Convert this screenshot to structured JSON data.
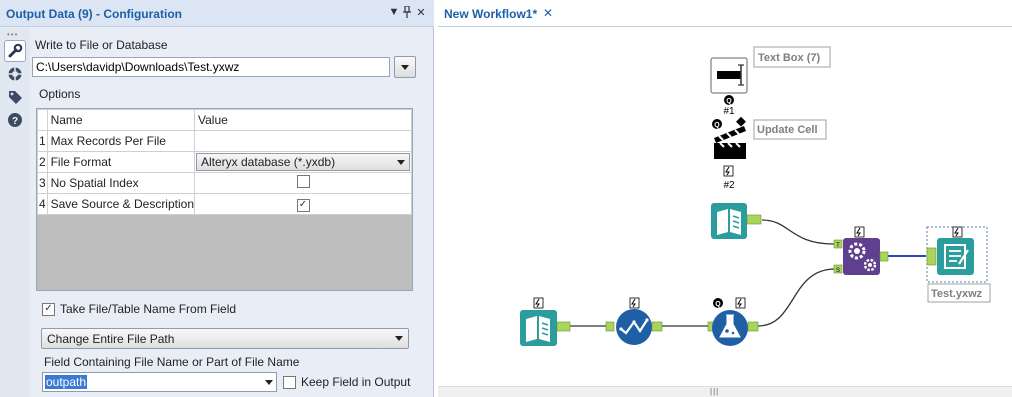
{
  "left_panel": {
    "title": "Output Data (9) - Configuration",
    "write_label": "Write to File or Database",
    "path_value": "C:\\Users\\davidp\\Downloads\\Test.yxwz",
    "options_label": "Options",
    "table": {
      "headers": [
        "Name",
        "Value"
      ],
      "rows": [
        {
          "num": "1",
          "name": "Max Records Per File",
          "value": ""
        },
        {
          "num": "2",
          "name": "File Format",
          "value": "Alteryx database (*.yxdb)"
        },
        {
          "num": "3",
          "name": "No Spatial Index",
          "checked": false
        },
        {
          "num": "4",
          "name": "Save Source & Description",
          "checked": true
        }
      ]
    },
    "take_file_label": "Take File/Table Name From Field",
    "take_file_checked": true,
    "change_path_value": "Change Entire File Path",
    "field_label": "Field Containing File Name or Part of File Name",
    "field_value": "outpath",
    "keep_field_label": "Keep Field in Output",
    "keep_field_checked": false
  },
  "workflow": {
    "tab_label": "New Workflow1*",
    "tools": [
      {
        "name": "Text Box",
        "annotation": "Text Box (7)",
        "badge": "#1"
      },
      {
        "name": "Update Cell",
        "annotation": "Update Cell",
        "badge": "#2"
      },
      {
        "name": "Input Data",
        "annotation": ""
      },
      {
        "name": "Batch Macro",
        "annotation": ""
      },
      {
        "name": "Output Data",
        "annotation": "Test.yxwz"
      },
      {
        "name": "Input Data",
        "annotation": ""
      },
      {
        "name": "Select",
        "annotation": ""
      },
      {
        "name": "Formula",
        "annotation": ""
      }
    ],
    "anchor_labels": {
      "t": "T",
      "s": "S"
    }
  },
  "colors": {
    "accent_blue": "#1d5fa8",
    "teal_tool": "#2a9d9c",
    "navy_tool": "#1f5fa5",
    "purple_tool": "#5f3f8e",
    "connector_green": "#a9d55f"
  }
}
